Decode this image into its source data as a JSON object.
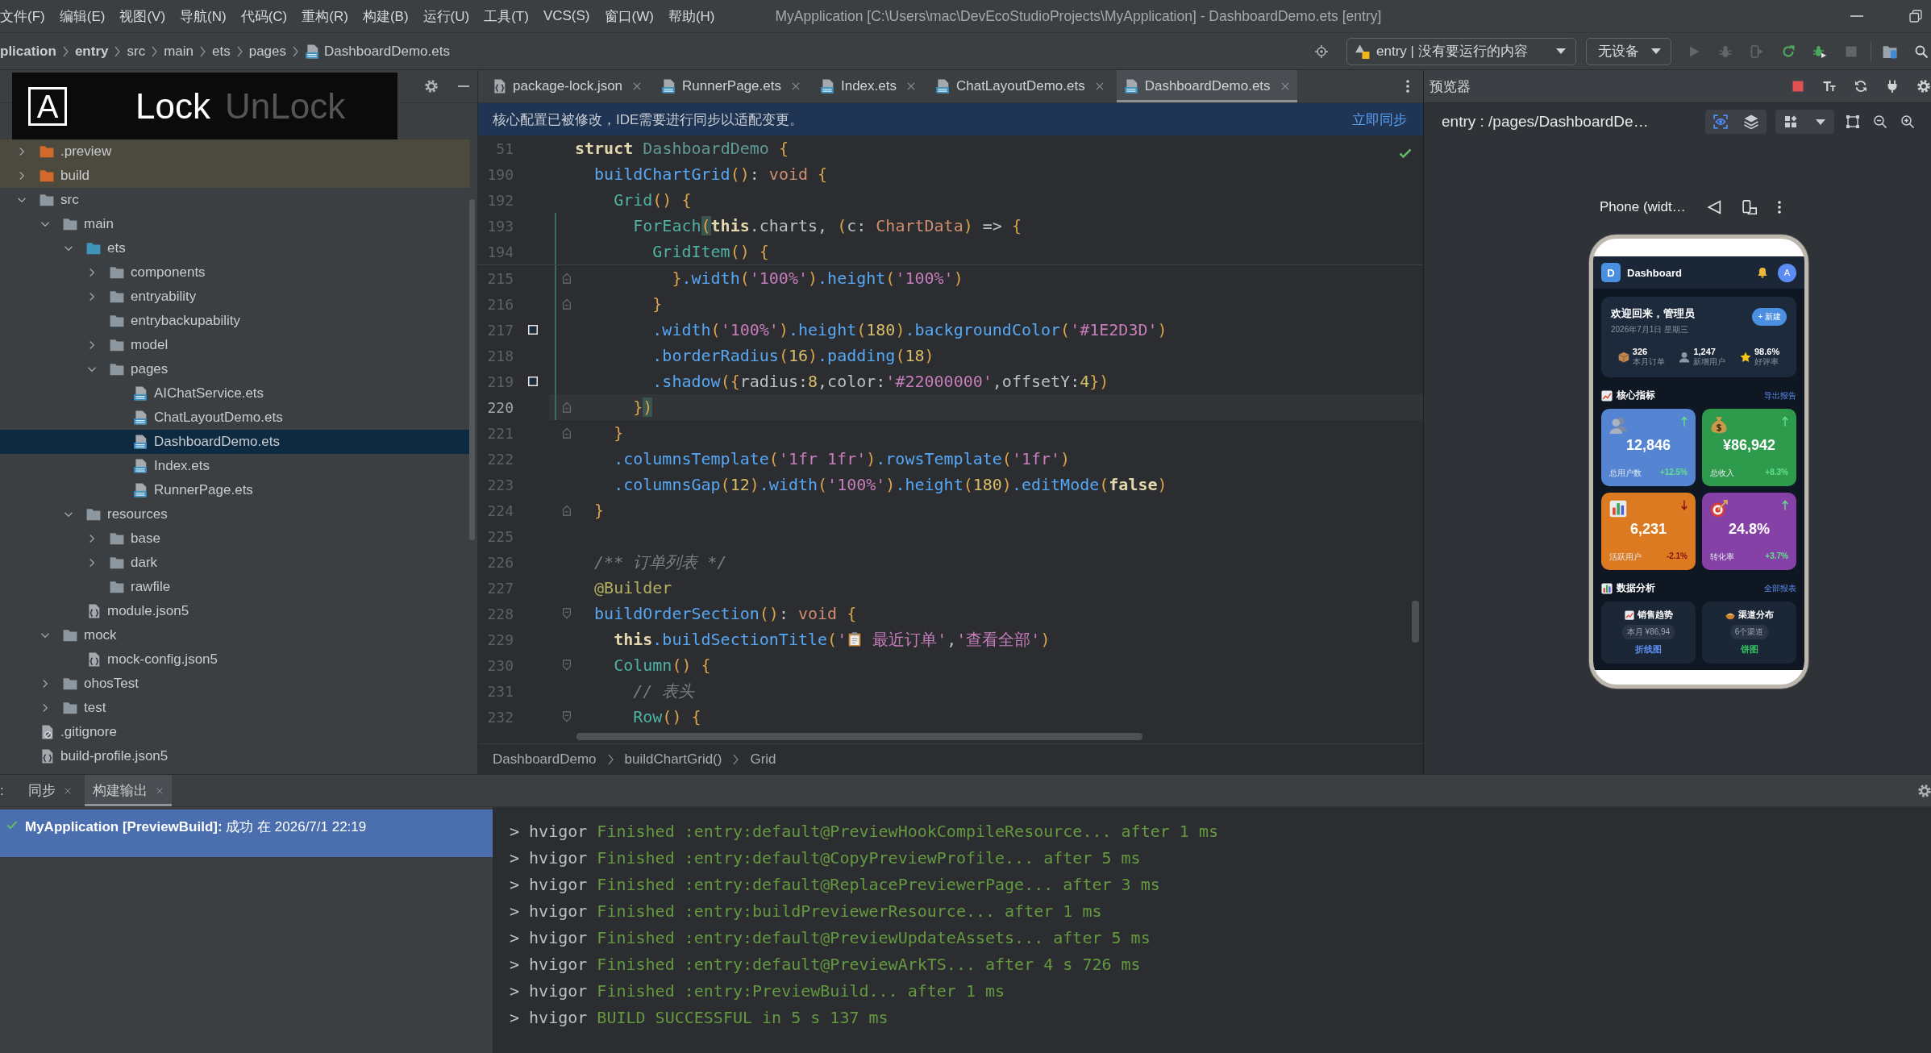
{
  "menu_bar": {
    "items": [
      "文件(F)",
      "编辑(E)",
      "视图(V)",
      "导航(N)",
      "代码(C)",
      "重构(R)",
      "构建(B)",
      "运行(U)",
      "工具(T)",
      "VCS(S)",
      "窗口(W)",
      "帮助(H)"
    ],
    "title": "MyApplication [C:\\Users\\mac\\DevEcoStudioProjects\\MyApplication] - DashboardDemo.ets [entry]"
  },
  "navigation_bar": {
    "breadcrumbs": [
      {
        "label": "plication",
        "kind": "project"
      },
      {
        "label": "entry",
        "kind": "module"
      },
      {
        "label": "src",
        "kind": "folder"
      },
      {
        "label": "main",
        "kind": "folder"
      },
      {
        "label": "ets",
        "kind": "folder"
      },
      {
        "label": "pages",
        "kind": "folder"
      },
      {
        "label": "DashboardDemo.ets",
        "kind": "file"
      }
    ],
    "run_configuration": "entry | 没有要运行的内容",
    "device": "无设备",
    "actions": [
      {
        "kind": "run",
        "disabled": true
      },
      {
        "kind": "debug",
        "disabled": true
      },
      {
        "kind": "profile",
        "disabled": true
      },
      {
        "kind": "reload",
        "disabled": false
      },
      {
        "kind": "apply",
        "disabled": false
      },
      {
        "kind": "stop",
        "disabled": true
      }
    ]
  },
  "project_panel": {
    "tree": [
      {
        "name": ".preview",
        "kind": "excluded-folder",
        "expanded": false,
        "selected": false
      },
      {
        "name": "build",
        "kind": "excluded-folder",
        "expanded": false,
        "selected": false
      },
      {
        "name": "src",
        "kind": "folder",
        "expanded": true,
        "selected": false,
        "children": [
          {
            "name": "main",
            "kind": "folder",
            "expanded": true,
            "selected": false,
            "children": [
              {
                "name": "ets",
                "kind": "source-folder",
                "expanded": true,
                "selected": false,
                "children": [
                  {
                    "name": "components",
                    "kind": "folder",
                    "expanded": false,
                    "selected": false
                  },
                  {
                    "name": "entryability",
                    "kind": "folder",
                    "expanded": false,
                    "selected": false
                  },
                  {
                    "name": "entrybackupability",
                    "kind": "folder",
                    "selected": false
                  },
                  {
                    "name": "model",
                    "kind": "folder",
                    "expanded": false,
                    "selected": false
                  },
                  {
                    "name": "pages",
                    "kind": "folder",
                    "expanded": true,
                    "selected": false,
                    "children": [
                      {
                        "name": "AIChatService.ets",
                        "kind": "ets",
                        "selected": false
                      },
                      {
                        "name": "ChatLayoutDemo.ets",
                        "kind": "ets",
                        "selected": false
                      },
                      {
                        "name": "DashboardDemo.ets",
                        "kind": "ets",
                        "selected": true
                      },
                      {
                        "name": "Index.ets",
                        "kind": "ets",
                        "selected": false
                      },
                      {
                        "name": "RunnerPage.ets",
                        "kind": "ets",
                        "selected": false
                      }
                    ]
                  }
                ]
              },
              {
                "name": "resources",
                "kind": "folder",
                "expanded": true,
                "selected": false,
                "children": [
                  {
                    "name": "base",
                    "kind": "folder",
                    "expanded": false,
                    "selected": false
                  },
                  {
                    "name": "dark",
                    "kind": "folder",
                    "expanded": false,
                    "selected": false
                  },
                  {
                    "name": "rawfile",
                    "kind": "folder",
                    "selected": false
                  }
                ]
              },
              {
                "name": "module.json5",
                "kind": "json",
                "selected": false
              }
            ]
          },
          {
            "name": "mock",
            "kind": "folder",
            "expanded": true,
            "selected": false,
            "children": [
              {
                "name": "mock-config.json5",
                "kind": "json",
                "selected": false
              }
            ]
          },
          {
            "name": "ohosTest",
            "kind": "folder",
            "expanded": false,
            "selected": false
          },
          {
            "name": "test",
            "kind": "folder",
            "expanded": false,
            "selected": false
          }
        ]
      },
      {
        "name": ".gitignore",
        "kind": "ignore",
        "selected": false
      },
      {
        "name": "build-profile.json5",
        "kind": "json",
        "selected": false
      }
    ]
  },
  "lock_overlay": {
    "key": "A",
    "states": [
      {
        "label": "Lock",
        "selected": true
      },
      {
        "label": "UnLock",
        "selected": false
      }
    ]
  },
  "editor": {
    "tabs": [
      {
        "label": "package-lock.json",
        "kind": "json",
        "selected": false
      },
      {
        "label": "RunnerPage.ets",
        "kind": "ets",
        "selected": false
      },
      {
        "label": "Index.ets",
        "kind": "ets",
        "selected": false
      },
      {
        "label": "ChatLayoutDemo.ets",
        "kind": "ets",
        "selected": false
      },
      {
        "label": "DashboardDemo.ets",
        "kind": "ets",
        "selected": true
      }
    ],
    "notice": {
      "text": "核心配置已被修改，IDE需要进行同步以适配变更。",
      "action": "立即同步"
    },
    "sticky_lines": [
      {
        "number": "51",
        "current": false,
        "modified": false,
        "tokens": [
          {
            "kind": "keyword",
            "text": "struct "
          },
          {
            "kind": "class",
            "text": "DashboardDemo "
          },
          {
            "kind": "bracket",
            "text": "{"
          }
        ]
      },
      {
        "number": "190",
        "current": false,
        "modified": false,
        "tokens": [
          {
            "kind": "method",
            "text": "  buildChartGrid"
          },
          {
            "kind": "bracket",
            "text": "()"
          },
          {
            "kind": "plain",
            "text": ": "
          },
          {
            "kind": "type",
            "text": "void "
          },
          {
            "kind": "bracket",
            "text": "{"
          }
        ]
      },
      {
        "number": "192",
        "current": false,
        "modified": false,
        "tokens": [
          {
            "kind": "component",
            "text": "    Grid"
          },
          {
            "kind": "bracket",
            "text": "() {"
          }
        ]
      },
      {
        "number": "193",
        "current": false,
        "modified": true,
        "tokens": [
          {
            "kind": "component",
            "text": "      ForEach"
          },
          {
            "kind": "bracket",
            "text": "(",
            "matched": true
          },
          {
            "kind": "keyword",
            "text": "this"
          },
          {
            "kind": "plain",
            "text": ".charts, "
          },
          {
            "kind": "bracket",
            "text": "("
          },
          {
            "kind": "plain",
            "text": "c: "
          },
          {
            "kind": "type",
            "text": "ChartData"
          },
          {
            "kind": "bracket",
            "text": ")"
          },
          {
            "kind": "plain",
            "text": " => "
          },
          {
            "kind": "bracket",
            "text": "{"
          }
        ]
      },
      {
        "number": "194",
        "current": false,
        "modified": true,
        "tokens": [
          {
            "kind": "component",
            "text": "        GridItem"
          },
          {
            "kind": "bracket",
            "text": "() {"
          }
        ]
      }
    ],
    "lines": [
      {
        "number": "215",
        "current": false,
        "modified": true,
        "fold_end": true,
        "tokens": [
          {
            "kind": "bracket",
            "text": "          }"
          },
          {
            "kind": "method",
            "text": ".width"
          },
          {
            "kind": "bracket",
            "text": "("
          },
          {
            "kind": "string",
            "text": "'100%'"
          },
          {
            "kind": "bracket",
            "text": ")"
          },
          {
            "kind": "method",
            "text": ".height"
          },
          {
            "kind": "bracket",
            "text": "("
          },
          {
            "kind": "string",
            "text": "'100%'"
          },
          {
            "kind": "bracket",
            "text": ")"
          }
        ]
      },
      {
        "number": "216",
        "current": false,
        "modified": true,
        "fold_end": true,
        "tokens": [
          {
            "kind": "bracket",
            "text": "        }"
          }
        ]
      },
      {
        "number": "217",
        "current": false,
        "modified": true,
        "swatch": true,
        "tokens": [
          {
            "kind": "method",
            "text": "        .width"
          },
          {
            "kind": "bracket",
            "text": "("
          },
          {
            "kind": "string",
            "text": "'100%'"
          },
          {
            "kind": "bracket",
            "text": ")"
          },
          {
            "kind": "method",
            "text": ".height"
          },
          {
            "kind": "bracket",
            "text": "("
          },
          {
            "kind": "number",
            "text": "180"
          },
          {
            "kind": "bracket",
            "text": ")"
          },
          {
            "kind": "method",
            "text": ".backgroundColor"
          },
          {
            "kind": "bracket",
            "text": "("
          },
          {
            "kind": "string",
            "text": "'#1E2D3D'"
          },
          {
            "kind": "bracket",
            "text": ")"
          }
        ]
      },
      {
        "number": "218",
        "current": false,
        "modified": true,
        "tokens": [
          {
            "kind": "method",
            "text": "        .borderRadius"
          },
          {
            "kind": "bracket",
            "text": "("
          },
          {
            "kind": "number",
            "text": "16"
          },
          {
            "kind": "bracket",
            "text": ")"
          },
          {
            "kind": "method",
            "text": ".padding"
          },
          {
            "kind": "bracket",
            "text": "("
          },
          {
            "kind": "number",
            "text": "18"
          },
          {
            "kind": "bracket",
            "text": ")"
          }
        ]
      },
      {
        "number": "219",
        "current": false,
        "modified": true,
        "swatch": true,
        "tokens": [
          {
            "kind": "method",
            "text": "        .shadow"
          },
          {
            "kind": "bracket",
            "text": "({"
          },
          {
            "kind": "plain",
            "text": "radius:"
          },
          {
            "kind": "number",
            "text": "8"
          },
          {
            "kind": "plain",
            "text": ",color:"
          },
          {
            "kind": "string",
            "text": "'#22000000'"
          },
          {
            "kind": "plain",
            "text": ",offsetY:"
          },
          {
            "kind": "number",
            "text": "4"
          },
          {
            "kind": "bracket",
            "text": "})"
          }
        ]
      },
      {
        "number": "220",
        "current": true,
        "modified": true,
        "fold_end": true,
        "tokens": [
          {
            "kind": "bracket",
            "text": "      }"
          },
          {
            "kind": "bracket",
            "text": ")",
            "matched": true
          }
        ]
      },
      {
        "number": "221",
        "current": false,
        "modified": false,
        "fold_end": true,
        "tokens": [
          {
            "kind": "bracket",
            "text": "    }"
          }
        ]
      },
      {
        "number": "222",
        "current": false,
        "modified": false,
        "tokens": [
          {
            "kind": "method",
            "text": "    .columnsTemplate"
          },
          {
            "kind": "bracket",
            "text": "("
          },
          {
            "kind": "string",
            "text": "'1fr 1fr'"
          },
          {
            "kind": "bracket",
            "text": ")"
          },
          {
            "kind": "method",
            "text": ".rowsTemplate"
          },
          {
            "kind": "bracket",
            "text": "("
          },
          {
            "kind": "string",
            "text": "'1fr'"
          },
          {
            "kind": "bracket",
            "text": ")"
          }
        ]
      },
      {
        "number": "223",
        "current": false,
        "modified": false,
        "tokens": [
          {
            "kind": "method",
            "text": "    .columnsGap"
          },
          {
            "kind": "bracket",
            "text": "("
          },
          {
            "kind": "number",
            "text": "12"
          },
          {
            "kind": "bracket",
            "text": ")"
          },
          {
            "kind": "method",
            "text": ".width"
          },
          {
            "kind": "bracket",
            "text": "("
          },
          {
            "kind": "string",
            "text": "'100%'"
          },
          {
            "kind": "bracket",
            "text": ")"
          },
          {
            "kind": "method",
            "text": ".height"
          },
          {
            "kind": "bracket",
            "text": "("
          },
          {
            "kind": "number",
            "text": "180"
          },
          {
            "kind": "bracket",
            "text": ")"
          },
          {
            "kind": "method",
            "text": ".editMode"
          },
          {
            "kind": "bracket",
            "text": "("
          },
          {
            "kind": "keyword",
            "text": "false"
          },
          {
            "kind": "bracket",
            "text": ")"
          }
        ]
      },
      {
        "number": "224",
        "current": false,
        "modified": false,
        "fold_end": true,
        "tokens": [
          {
            "kind": "bracket",
            "text": "  }"
          }
        ]
      },
      {
        "number": "225",
        "current": false,
        "modified": false
      },
      {
        "number": "226",
        "current": false,
        "modified": false,
        "tokens": [
          {
            "kind": "comment",
            "text": "  /** 订单列表 */"
          }
        ]
      },
      {
        "number": "227",
        "current": false,
        "modified": false,
        "tokens": [
          {
            "kind": "annotation",
            "text": "  @Builder"
          }
        ]
      },
      {
        "number": "228",
        "current": false,
        "modified": false,
        "fold_start": true,
        "tokens": [
          {
            "kind": "method",
            "text": "  buildOrderSection"
          },
          {
            "kind": "bracket",
            "text": "()"
          },
          {
            "kind": "plain",
            "text": ": "
          },
          {
            "kind": "type",
            "text": "void "
          },
          {
            "kind": "bracket",
            "text": "{"
          }
        ]
      },
      {
        "number": "229",
        "current": false,
        "modified": false,
        "tokens": [
          {
            "kind": "keyword",
            "text": "    this"
          },
          {
            "kind": "method",
            "text": ".buildSectionTitle"
          },
          {
            "kind": "bracket",
            "text": "("
          },
          {
            "kind": "string",
            "text": "'"
          },
          {
            "kind": "icon"
          },
          {
            "kind": "string",
            "text": " 最近订单'"
          },
          {
            "kind": "plain",
            "text": ","
          },
          {
            "kind": "string",
            "text": "'查看全部'"
          },
          {
            "kind": "bracket",
            "text": ")"
          }
        ]
      },
      {
        "number": "230",
        "current": false,
        "modified": false,
        "fold_start": true,
        "tokens": [
          {
            "kind": "component",
            "text": "    Column"
          },
          {
            "kind": "bracket",
            "text": "() {"
          }
        ]
      },
      {
        "number": "231",
        "current": false,
        "modified": false,
        "tokens": [
          {
            "kind": "comment",
            "text": "      // 表头"
          }
        ]
      },
      {
        "number": "232",
        "current": false,
        "modified": false,
        "fold_start": true,
        "tokens": [
          {
            "kind": "component",
            "text": "      Row"
          },
          {
            "kind": "bracket",
            "text": "() {"
          }
        ]
      }
    ],
    "breadcrumbs": [
      "DashboardDemo",
      "buildChartGrid()",
      "Grid"
    ]
  },
  "preview": {
    "title": "预览器",
    "tools": [
      {
        "kind": "stop"
      },
      {
        "kind": "font-size"
      },
      {
        "kind": "refresh"
      },
      {
        "kind": "plug"
      },
      {
        "kind": "settings"
      }
    ],
    "page_path": "entry : /pages/DashboardDe…",
    "view_modes": [
      {
        "kind": "inspect",
        "selected": true
      },
      {
        "kind": "layers",
        "selected": false
      }
    ],
    "view_tools": [
      {
        "kind": "components"
      },
      {
        "kind": "dropdown"
      }
    ],
    "zoom_tools": [
      {
        "kind": "frame"
      },
      {
        "kind": "zoom-out"
      },
      {
        "kind": "zoom-in"
      }
    ],
    "device_label": "Phone (widt…",
    "device_tools": [
      {
        "kind": "back"
      },
      {
        "kind": "rotate"
      },
      {
        "kind": "more"
      }
    ],
    "phone": {
      "app_bar": {
        "logo": "D",
        "title": "Dashboard",
        "avatar": "A"
      },
      "welcome": {
        "title": "欢迎回来，管理员",
        "date": "2026年7月1日 星期三",
        "action": "+ 新建",
        "stats": [
          {
            "kind": "box",
            "value": "326",
            "label": "本月订单"
          },
          {
            "kind": "user",
            "value": "1,247",
            "label": "新增用户"
          },
          {
            "kind": "star",
            "value": "98.6%",
            "label": "好评率"
          }
        ]
      },
      "metrics_header": {
        "kind": "trend",
        "title": "核心指标",
        "action": "导出报告"
      },
      "metrics": [
        {
          "kind": "users",
          "value": "12,846",
          "label": "总用户数",
          "change": "+12.5%",
          "rising": true,
          "color": "#5585d2"
        },
        {
          "kind": "money",
          "value": "¥86,942",
          "label": "总收入",
          "change": "+8.3%",
          "rising": true,
          "color": "#2e9a4c"
        },
        {
          "kind": "bars",
          "value": "6,231",
          "label": "活跃用户",
          "change": "-2.1%",
          "rising": false,
          "color": "#dc7a22"
        },
        {
          "kind": "target",
          "value": "24.8%",
          "label": "转化率",
          "change": "+3.7%",
          "rising": true,
          "color": "#8641a6"
        }
      ],
      "analysis_header": {
        "kind": "bars",
        "title": "数据分析",
        "action": "全部报表"
      },
      "charts": [
        {
          "kind": "line",
          "title": "销售趋势",
          "badge": "本月 ¥86,94",
          "type_label": "折线图",
          "color": "#5b8ff0"
        },
        {
          "kind": "pie",
          "title": "渠道分布",
          "badge": "6个渠道",
          "type_label": "饼图",
          "color": "#34c060"
        }
      ]
    }
  },
  "bottom_panel": {
    "title": ":",
    "tabs": [
      {
        "label": "同步",
        "selected": false
      },
      {
        "label": "构建输出",
        "selected": true
      }
    ],
    "builds": [
      {
        "text": "**MyApplication [PreviewBuild]:** 成功 在 2026/7/1 22:19",
        "succeeded": true,
        "selected": true
      }
    ],
    "console": [
      {
        "prefix": "> hvigor",
        "message": "Finished :entry:default@PreviewHookCompileResource... after 1 ms"
      },
      {
        "prefix": "> hvigor",
        "message": "Finished :entry:default@CopyPreviewProfile... after 5 ms"
      },
      {
        "prefix": "> hvigor",
        "message": "Finished :entry:default@ReplacePreviewerPage... after 3 ms"
      },
      {
        "prefix": "> hvigor",
        "message": "Finished :entry:buildPreviewerResource... after 1 ms"
      },
      {
        "prefix": "> hvigor",
        "message": "Finished :entry:default@PreviewUpdateAssets... after 5 ms"
      },
      {
        "prefix": "> hvigor",
        "message": "Finished :entry:default@PreviewArkTS... after 4 s 726 ms"
      },
      {
        "prefix": "> hvigor",
        "message": "Finished :entry:PreviewBuild... after 1 ms"
      },
      {
        "prefix": "> hvigor",
        "message": "BUILD SUCCESSFUL in 5 s 137 ms"
      }
    ]
  }
}
